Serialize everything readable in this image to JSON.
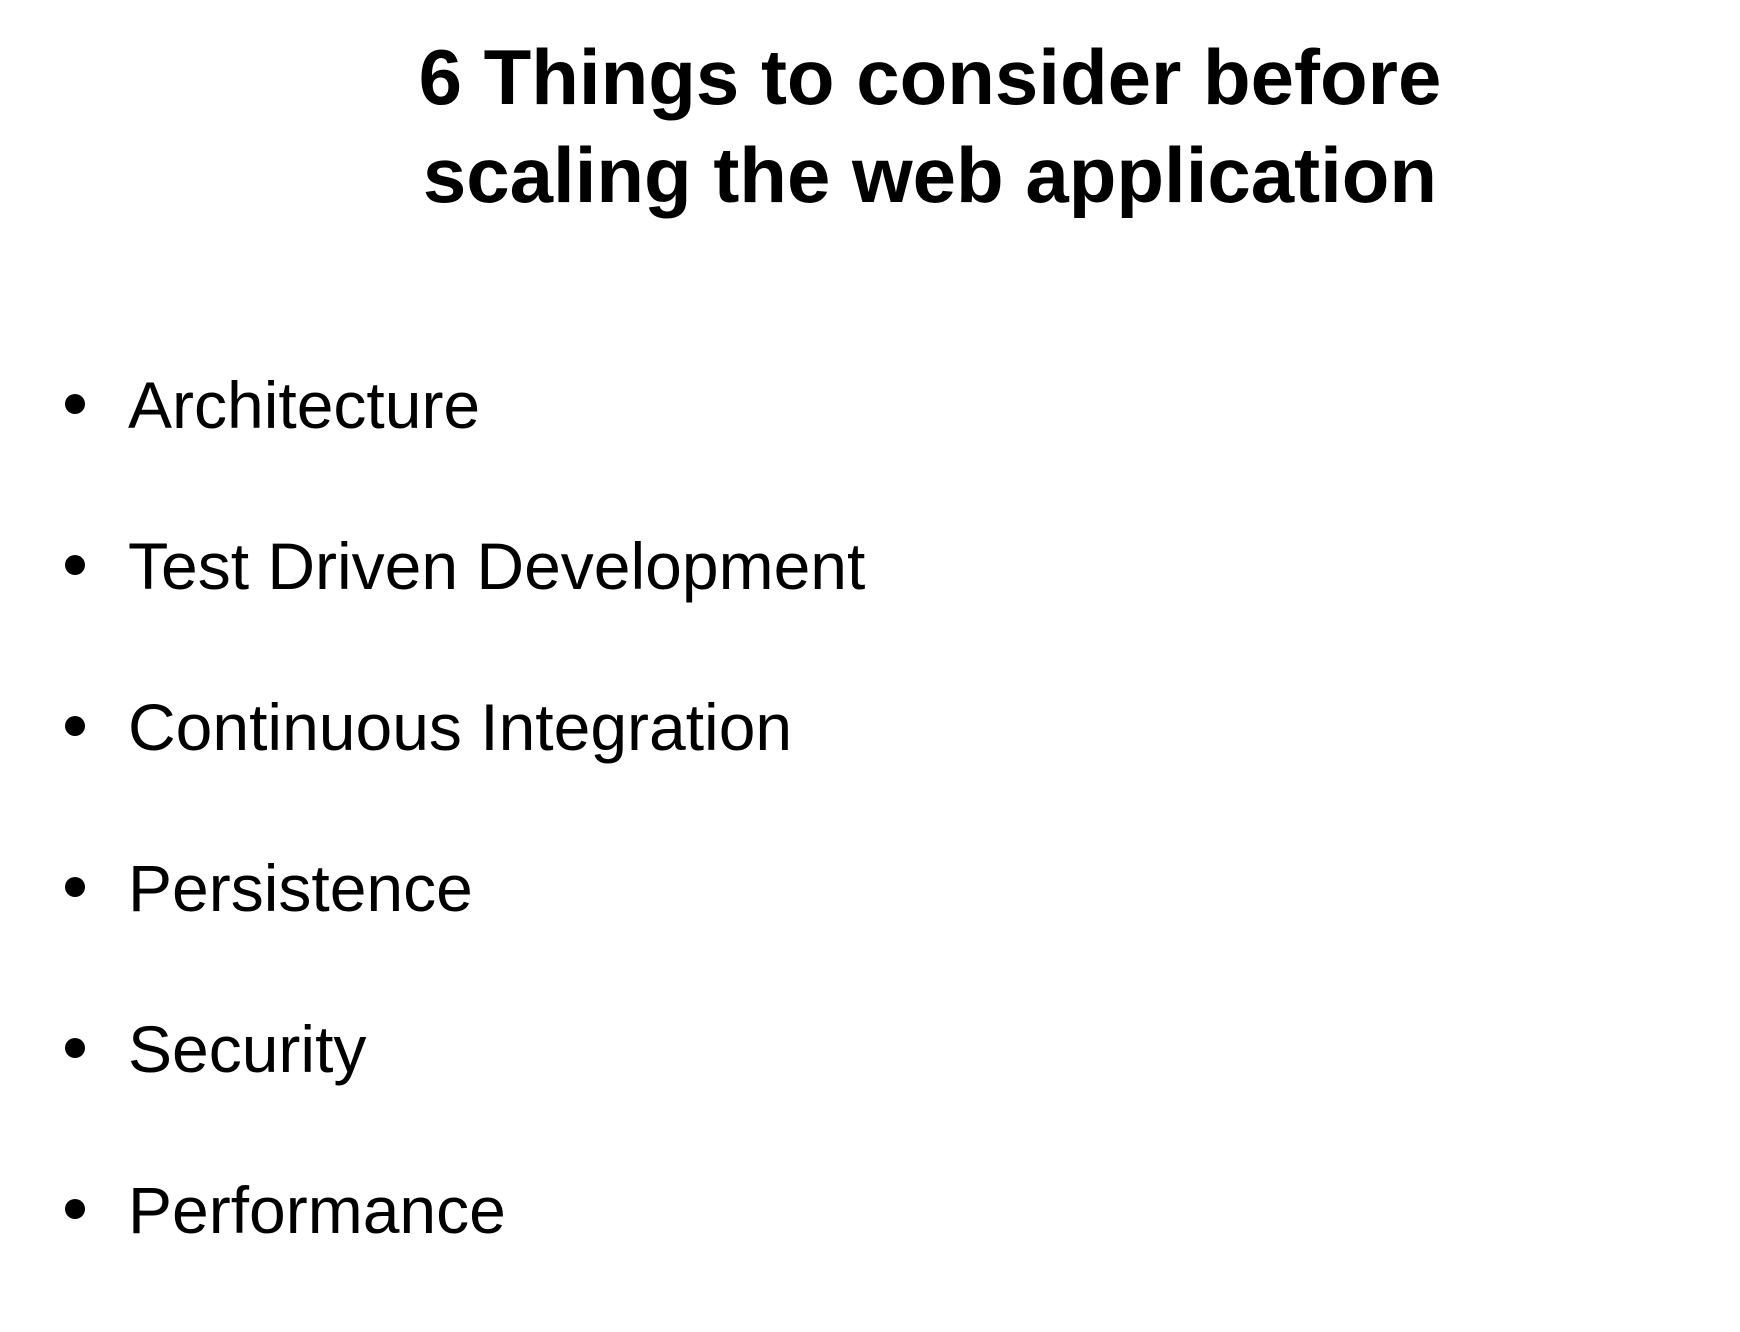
{
  "slide": {
    "title_lines": [
      "6 Things to consider before",
      "scaling the web application"
    ],
    "bullets": [
      "Architecture",
      "Test Driven Development",
      "Continuous Integration",
      "Persistence",
      "Security",
      "Performance"
    ]
  }
}
